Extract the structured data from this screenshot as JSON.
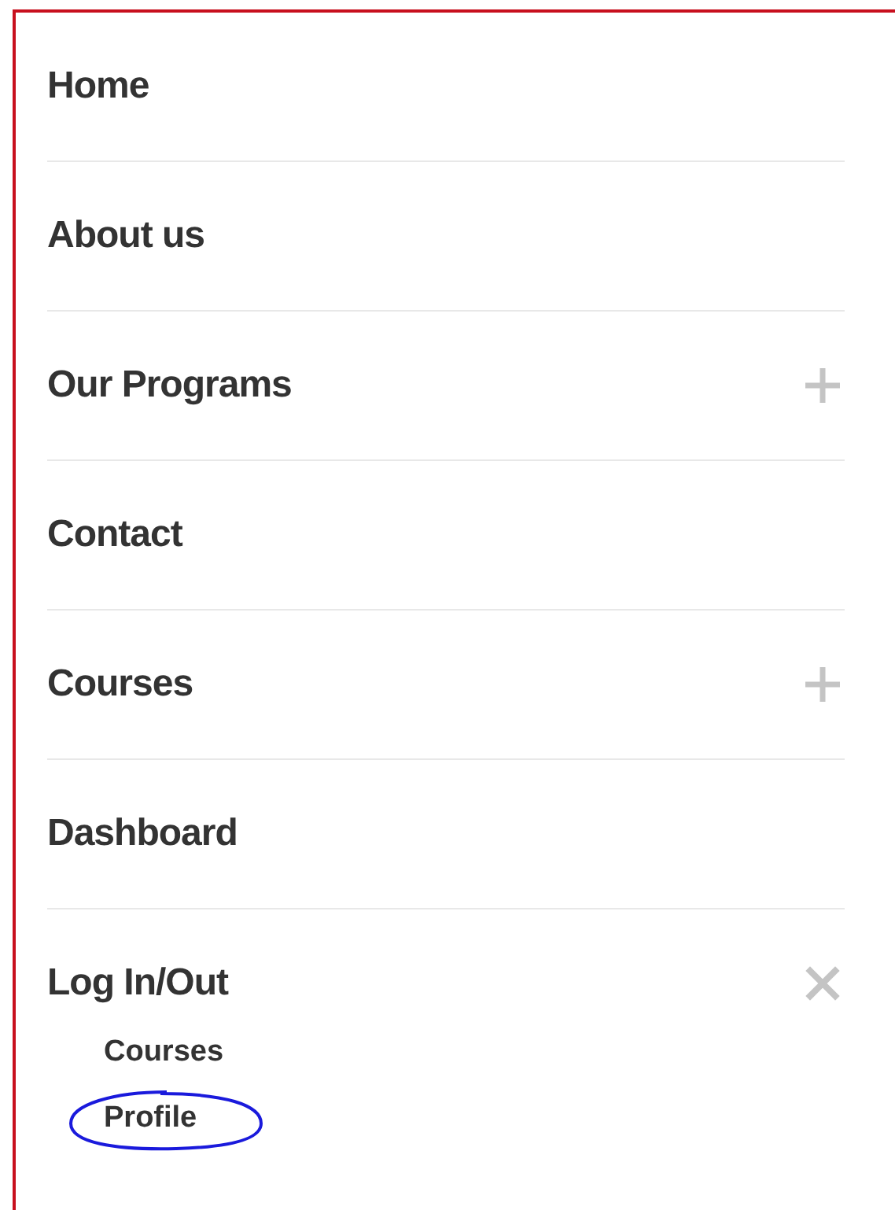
{
  "menu": {
    "items": [
      {
        "label": "Home"
      },
      {
        "label": "About us"
      },
      {
        "label": "Our Programs",
        "expanded": false
      },
      {
        "label": "Contact"
      },
      {
        "label": "Courses",
        "expanded": false
      },
      {
        "label": "Dashboard"
      },
      {
        "label": "Log In/Out",
        "expanded": true,
        "children": [
          {
            "label": "Courses",
            "circled": false
          },
          {
            "label": "Profile",
            "circled": true
          }
        ]
      }
    ]
  }
}
